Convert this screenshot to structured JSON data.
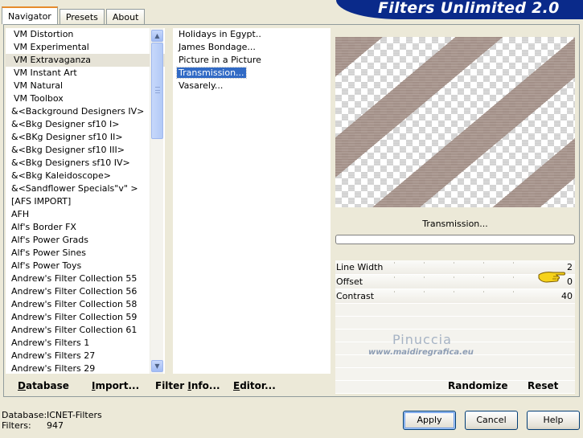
{
  "tabs": [
    {
      "label": "Navigator",
      "active": true
    },
    {
      "label": "Presets",
      "active": false
    },
    {
      "label": "About",
      "active": false
    }
  ],
  "banner_title": "Filters Unlimited 2.0",
  "categories": [
    {
      "label": "VM Distortion",
      "indent": true,
      "selected": false
    },
    {
      "label": "VM Experimental",
      "indent": true,
      "selected": false
    },
    {
      "label": "VM Extravaganza",
      "indent": true,
      "selected": true
    },
    {
      "label": "VM Instant Art",
      "indent": true,
      "selected": false
    },
    {
      "label": "VM Natural",
      "indent": true,
      "selected": false
    },
    {
      "label": "VM Toolbox",
      "indent": true,
      "selected": false
    },
    {
      "label": "&<Background Designers IV>",
      "indent": false,
      "selected": false
    },
    {
      "label": "&<Bkg Designer sf10 I>",
      "indent": false,
      "selected": false
    },
    {
      "label": "&<BKg Designer sf10 II>",
      "indent": false,
      "selected": false
    },
    {
      "label": "&<Bkg Designer sf10 III>",
      "indent": false,
      "selected": false
    },
    {
      "label": "&<Bkg Designers sf10 IV>",
      "indent": false,
      "selected": false
    },
    {
      "label": "&<Bkg Kaleidoscope>",
      "indent": false,
      "selected": false
    },
    {
      "label": "&<Sandflower Specials\"v\" >",
      "indent": false,
      "selected": false
    },
    {
      "label": "[AFS IMPORT]",
      "indent": false,
      "selected": false
    },
    {
      "label": "AFH",
      "indent": false,
      "selected": false
    },
    {
      "label": "Alf's Border FX",
      "indent": false,
      "selected": false
    },
    {
      "label": "Alf's Power Grads",
      "indent": false,
      "selected": false
    },
    {
      "label": "Alf's Power Sines",
      "indent": false,
      "selected": false
    },
    {
      "label": "Alf's Power Toys",
      "indent": false,
      "selected": false
    },
    {
      "label": "Andrew's Filter Collection 55",
      "indent": false,
      "selected": false
    },
    {
      "label": "Andrew's Filter Collection 56",
      "indent": false,
      "selected": false
    },
    {
      "label": "Andrew's Filter Collection 58",
      "indent": false,
      "selected": false
    },
    {
      "label": "Andrew's Filter Collection 59",
      "indent": false,
      "selected": false
    },
    {
      "label": "Andrew's Filter Collection 61",
      "indent": false,
      "selected": false
    },
    {
      "label": "Andrew's Filters 1",
      "indent": false,
      "selected": false
    },
    {
      "label": "Andrew's Filters 27",
      "indent": false,
      "selected": false
    },
    {
      "label": "Andrew's Filters 29",
      "indent": false,
      "selected": false
    }
  ],
  "effects": [
    {
      "label": "Holidays in Egypt..",
      "selected": false
    },
    {
      "label": "James Bondage...",
      "selected": false
    },
    {
      "label": "Picture in a Picture",
      "selected": false
    },
    {
      "label": "Transmission...",
      "selected": true
    },
    {
      "label": "Vasarely...",
      "selected": false
    }
  ],
  "preview": {
    "stripe_color": "#968076",
    "background": "transparency-checkerboard"
  },
  "effect_name": "Transmission...",
  "params": [
    {
      "label": "Line Width",
      "value": "2"
    },
    {
      "label": "Offset",
      "value": "0"
    },
    {
      "label": "Contrast",
      "value": "40"
    }
  ],
  "pointer_icon": "hand-pointer-icon",
  "watermark": {
    "name": "Pinuccia",
    "url": "www.maidiregrafica.eu"
  },
  "panel_buttons": {
    "database": {
      "pre": "",
      "ul": "D",
      "post": "atabase"
    },
    "import": {
      "pre": "",
      "ul": "I",
      "post": "mport..."
    },
    "filter_info": {
      "pre": "Filter ",
      "ul": "I",
      "post": "nfo..."
    },
    "editor": {
      "pre": "",
      "ul": "E",
      "post": "ditor..."
    },
    "randomize": "Randomize",
    "reset": "Reset"
  },
  "footer": {
    "database_label": "Database:",
    "database_value": "ICNET-Filters",
    "filters_label": "Filters:",
    "filters_value": "947"
  },
  "dialog_buttons": {
    "apply": "Apply",
    "cancel": "Cancel",
    "help": "Help"
  }
}
